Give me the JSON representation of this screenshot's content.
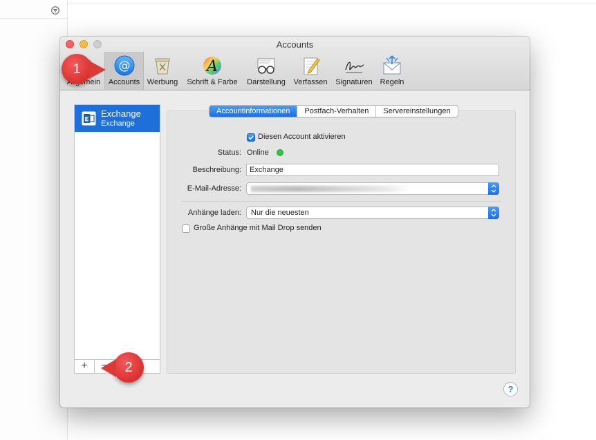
{
  "window": {
    "title": "Accounts"
  },
  "toolbar": {
    "items": [
      {
        "label": "Allgemein",
        "icon": "switch-icon"
      },
      {
        "label": "Accounts",
        "icon": "at-sign-icon"
      },
      {
        "label": "Werbung",
        "icon": "trash-bin-icon"
      },
      {
        "label": "Schrift & Farbe",
        "icon": "font-color-icon"
      },
      {
        "label": "Darstellung",
        "icon": "glasses-icon"
      },
      {
        "label": "Verfassen",
        "icon": "pencil-paper-icon"
      },
      {
        "label": "Signaturen",
        "icon": "signature-icon"
      },
      {
        "label": "Regeln",
        "icon": "rules-envelope-icon"
      }
    ],
    "active": "Accounts"
  },
  "accounts": {
    "list": [
      {
        "name": "Exchange",
        "type": "Exchange",
        "icon": "exchange-icon"
      }
    ],
    "add_label": "+",
    "remove_label": "−"
  },
  "tabs": [
    {
      "label": "Accountinformationen",
      "active": true
    },
    {
      "label": "Postfach-Verhalten",
      "active": false
    },
    {
      "label": "Servereinstellungen",
      "active": false
    }
  ],
  "form": {
    "enable_label": "Diesen Account aktivieren",
    "enable_checked": true,
    "status_label": "Status:",
    "status_value": "Online",
    "status_color": "#2fc544",
    "description_label": "Beschreibung:",
    "description_value": "Exchange",
    "email_label": "E-Mail-Adresse:",
    "attachments_label": "Anhänge laden:",
    "attachments_value": "Nur die neuesten",
    "maildrop_label": "Große Anhänge mit Mail Drop senden",
    "maildrop_checked": false
  },
  "help": {
    "label": "?"
  },
  "markers": {
    "one": "1",
    "two": "2"
  },
  "colors": {
    "accent": "#1e6fd9",
    "marker": "#d8312f"
  }
}
